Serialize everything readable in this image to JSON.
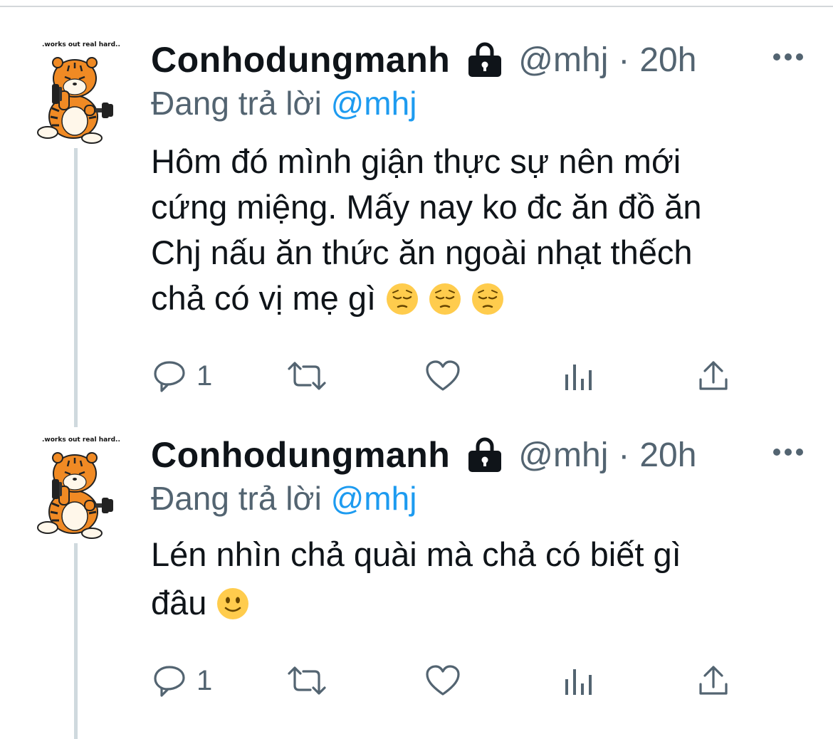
{
  "colors": {
    "text": "#0f1419",
    "secondary": "#536471",
    "accent": "#1d9bf0",
    "thread_line": "#cfd9de"
  },
  "tweets": [
    {
      "avatar_caption": ".works out real hard..",
      "display_name": "Conhodungmanh",
      "protected_icon": "lock-icon",
      "handle": "@mhj",
      "separator": "·",
      "time": "20h",
      "reply_prefix": "Đang trả lời",
      "reply_to": "@mhj",
      "text": "Hôm đó mình giận thực sự nên mới\ncứng miệng. Mấy nay ko đc ăn đồ ăn\nChj nấu ăn thức ăn ngoài nhạt thếch\nchả có vị mẹ gì",
      "emojis": [
        "pensive-face-emoji",
        "pensive-face-emoji",
        "pensive-face-emoji"
      ],
      "reply_count": "1"
    },
    {
      "avatar_caption": ".works out real hard..",
      "display_name": "Conhodungmanh",
      "protected_icon": "lock-icon",
      "handle": "@mhj",
      "separator": "·",
      "time": "20h",
      "reply_prefix": "Đang trả lời",
      "reply_to": "@mhj",
      "text": "Lén nhìn chả quài mà chả có biết gì\nđâu",
      "emojis": [
        "slightly-smiling-face-emoji"
      ],
      "reply_count": "1"
    }
  ]
}
